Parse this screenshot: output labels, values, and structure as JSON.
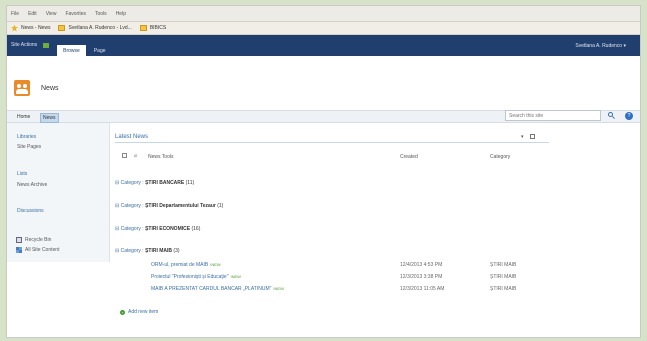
{
  "browser": {
    "menu": [
      "File",
      "Edit",
      "View",
      "Favorites",
      "Tools",
      "Help"
    ],
    "favorites": [
      {
        "label": "News - News",
        "icon": "star-icon"
      },
      {
        "label": "Svetlana A. Rudenco - Lvd...",
        "icon": "folder-icon"
      },
      {
        "label": "BIBICS",
        "icon": "folder-icon"
      }
    ]
  },
  "ribbon": {
    "site_actions": "Site Actions",
    "tabs": [
      {
        "label": "Browse",
        "active": true
      },
      {
        "label": "Page",
        "active": false
      }
    ],
    "user": "Svetlana A. Rudenco ▾"
  },
  "site": {
    "title": "News",
    "icon": "people-icon"
  },
  "topnav": {
    "items": [
      "Home",
      "News"
    ],
    "selected": "News",
    "search_placeholder": "Search this site",
    "help": "?"
  },
  "quicklaunch": {
    "libraries": "Libraries",
    "site_pages": "Site Pages",
    "lists": "Lists",
    "news_archive": "News Archive",
    "discussions": "Discussions",
    "recycle_bin": "Recycle Bin",
    "all_site_content": "All Site Content"
  },
  "webpart": {
    "title": "Latest News",
    "control": "▾",
    "columns": {
      "title": "News Tools",
      "created": "Created",
      "category": "Category"
    },
    "groups": [
      {
        "prefix": "Category :",
        "name": "ȘTIRI BANCARE",
        "count": "(11)"
      },
      {
        "prefix": "Category :",
        "name": "ȘTIRI Departamentului Tezaur",
        "count": "(1)"
      },
      {
        "prefix": "Category :",
        "name": "ȘTIRI ECONOMICE",
        "count": "(16)"
      },
      {
        "prefix": "Category :",
        "name": "ȘTIRI MAIB",
        "count": "(3)"
      }
    ],
    "rows": [
      {
        "title": "ORM-ul, premiat de MAIB",
        "new": "!NEW",
        "created": "12/4/2013 4:53 PM",
        "category": "ȘTIRI MAIB"
      },
      {
        "title": "Proiectul \"Profesionişti și Educaţie\"",
        "new": "!NEW",
        "created": "12/3/2013 3:38 PM",
        "category": "ȘTIRI MAIB"
      },
      {
        "title": "MAIB A PREZENTAT CARDUL BANCAR „PLATINUM\"",
        "new": "!NEW",
        "created": "12/3/2013 11:05 AM",
        "category": "ȘTIRI MAIB"
      }
    ],
    "add_item": "Add new item"
  }
}
